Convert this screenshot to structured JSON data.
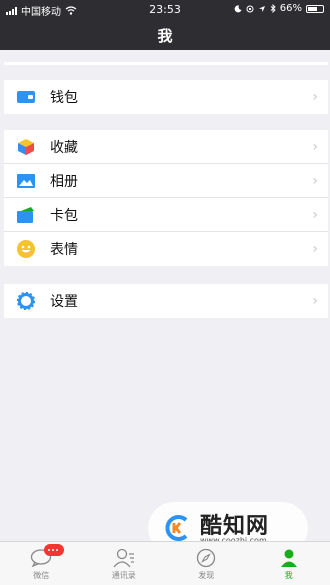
{
  "status": {
    "carrier": "中国移动",
    "time": "23:53",
    "battery": "66%",
    "battery_level": 0.66
  },
  "nav": {
    "title": "我"
  },
  "groups": {
    "wallet": {
      "label": "钱包"
    },
    "favorites": {
      "label": "收藏"
    },
    "album": {
      "label": "相册"
    },
    "cards": {
      "label": "卡包"
    },
    "stickers": {
      "label": "表情"
    },
    "settings": {
      "label": "设置"
    }
  },
  "tabs": [
    {
      "label": "微信",
      "icon": "chat-icon"
    },
    {
      "label": "通讯录",
      "icon": "contacts-icon"
    },
    {
      "label": "发现",
      "icon": "compass-icon"
    },
    {
      "label": "我",
      "icon": "me-icon"
    }
  ],
  "watermark": {
    "brand": "酷知网",
    "url": "www.coozhi.com"
  },
  "colors": {
    "bar": "#2e2e32",
    "bg": "#efeff4",
    "accent": "#1aad19",
    "badge": "#f43530"
  }
}
